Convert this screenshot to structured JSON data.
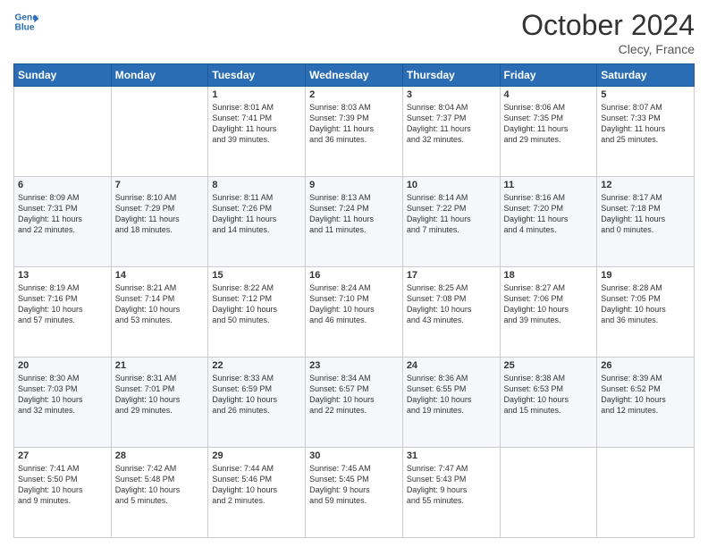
{
  "header": {
    "logo_line1": "General",
    "logo_line2": "Blue",
    "month": "October 2024",
    "location": "Clecy, France"
  },
  "weekdays": [
    "Sunday",
    "Monday",
    "Tuesday",
    "Wednesday",
    "Thursday",
    "Friday",
    "Saturday"
  ],
  "rows": [
    [
      {
        "day": "",
        "info": ""
      },
      {
        "day": "",
        "info": ""
      },
      {
        "day": "1",
        "info": "Sunrise: 8:01 AM\nSunset: 7:41 PM\nDaylight: 11 hours\nand 39 minutes."
      },
      {
        "day": "2",
        "info": "Sunrise: 8:03 AM\nSunset: 7:39 PM\nDaylight: 11 hours\nand 36 minutes."
      },
      {
        "day": "3",
        "info": "Sunrise: 8:04 AM\nSunset: 7:37 PM\nDaylight: 11 hours\nand 32 minutes."
      },
      {
        "day": "4",
        "info": "Sunrise: 8:06 AM\nSunset: 7:35 PM\nDaylight: 11 hours\nand 29 minutes."
      },
      {
        "day": "5",
        "info": "Sunrise: 8:07 AM\nSunset: 7:33 PM\nDaylight: 11 hours\nand 25 minutes."
      }
    ],
    [
      {
        "day": "6",
        "info": "Sunrise: 8:09 AM\nSunset: 7:31 PM\nDaylight: 11 hours\nand 22 minutes."
      },
      {
        "day": "7",
        "info": "Sunrise: 8:10 AM\nSunset: 7:29 PM\nDaylight: 11 hours\nand 18 minutes."
      },
      {
        "day": "8",
        "info": "Sunrise: 8:11 AM\nSunset: 7:26 PM\nDaylight: 11 hours\nand 14 minutes."
      },
      {
        "day": "9",
        "info": "Sunrise: 8:13 AM\nSunset: 7:24 PM\nDaylight: 11 hours\nand 11 minutes."
      },
      {
        "day": "10",
        "info": "Sunrise: 8:14 AM\nSunset: 7:22 PM\nDaylight: 11 hours\nand 7 minutes."
      },
      {
        "day": "11",
        "info": "Sunrise: 8:16 AM\nSunset: 7:20 PM\nDaylight: 11 hours\nand 4 minutes."
      },
      {
        "day": "12",
        "info": "Sunrise: 8:17 AM\nSunset: 7:18 PM\nDaylight: 11 hours\nand 0 minutes."
      }
    ],
    [
      {
        "day": "13",
        "info": "Sunrise: 8:19 AM\nSunset: 7:16 PM\nDaylight: 10 hours\nand 57 minutes."
      },
      {
        "day": "14",
        "info": "Sunrise: 8:21 AM\nSunset: 7:14 PM\nDaylight: 10 hours\nand 53 minutes."
      },
      {
        "day": "15",
        "info": "Sunrise: 8:22 AM\nSunset: 7:12 PM\nDaylight: 10 hours\nand 50 minutes."
      },
      {
        "day": "16",
        "info": "Sunrise: 8:24 AM\nSunset: 7:10 PM\nDaylight: 10 hours\nand 46 minutes."
      },
      {
        "day": "17",
        "info": "Sunrise: 8:25 AM\nSunset: 7:08 PM\nDaylight: 10 hours\nand 43 minutes."
      },
      {
        "day": "18",
        "info": "Sunrise: 8:27 AM\nSunset: 7:06 PM\nDaylight: 10 hours\nand 39 minutes."
      },
      {
        "day": "19",
        "info": "Sunrise: 8:28 AM\nSunset: 7:05 PM\nDaylight: 10 hours\nand 36 minutes."
      }
    ],
    [
      {
        "day": "20",
        "info": "Sunrise: 8:30 AM\nSunset: 7:03 PM\nDaylight: 10 hours\nand 32 minutes."
      },
      {
        "day": "21",
        "info": "Sunrise: 8:31 AM\nSunset: 7:01 PM\nDaylight: 10 hours\nand 29 minutes."
      },
      {
        "day": "22",
        "info": "Sunrise: 8:33 AM\nSunset: 6:59 PM\nDaylight: 10 hours\nand 26 minutes."
      },
      {
        "day": "23",
        "info": "Sunrise: 8:34 AM\nSunset: 6:57 PM\nDaylight: 10 hours\nand 22 minutes."
      },
      {
        "day": "24",
        "info": "Sunrise: 8:36 AM\nSunset: 6:55 PM\nDaylight: 10 hours\nand 19 minutes."
      },
      {
        "day": "25",
        "info": "Sunrise: 8:38 AM\nSunset: 6:53 PM\nDaylight: 10 hours\nand 15 minutes."
      },
      {
        "day": "26",
        "info": "Sunrise: 8:39 AM\nSunset: 6:52 PM\nDaylight: 10 hours\nand 12 minutes."
      }
    ],
    [
      {
        "day": "27",
        "info": "Sunrise: 7:41 AM\nSunset: 5:50 PM\nDaylight: 10 hours\nand 9 minutes."
      },
      {
        "day": "28",
        "info": "Sunrise: 7:42 AM\nSunset: 5:48 PM\nDaylight: 10 hours\nand 5 minutes."
      },
      {
        "day": "29",
        "info": "Sunrise: 7:44 AM\nSunset: 5:46 PM\nDaylight: 10 hours\nand 2 minutes."
      },
      {
        "day": "30",
        "info": "Sunrise: 7:45 AM\nSunset: 5:45 PM\nDaylight: 9 hours\nand 59 minutes."
      },
      {
        "day": "31",
        "info": "Sunrise: 7:47 AM\nSunset: 5:43 PM\nDaylight: 9 hours\nand 55 minutes."
      },
      {
        "day": "",
        "info": ""
      },
      {
        "day": "",
        "info": ""
      }
    ]
  ]
}
